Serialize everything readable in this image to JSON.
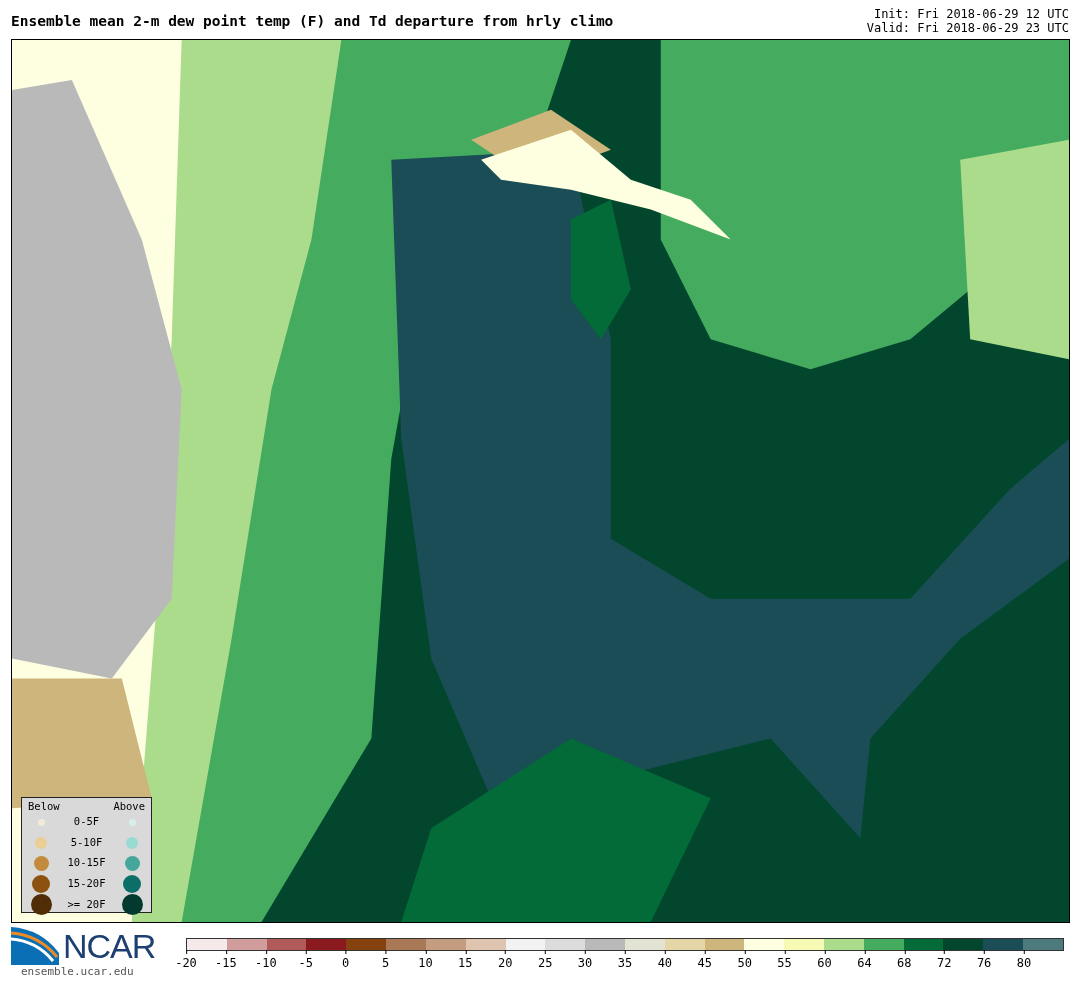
{
  "title": "Ensemble mean 2-m dew point temp (F) and Td departure from hrly climo",
  "init": "Init: Fri 2018-06-29 12 UTC",
  "valid": "Valid: Fri 2018-06-29 23 UTC",
  "legend": {
    "below_heading": "Below",
    "above_heading": "Above",
    "rows": [
      {
        "label": "0-5F",
        "below": {
          "color": "#f3ebd8"
        },
        "above": {
          "color": "#d7efec"
        }
      },
      {
        "label": "5-10F",
        "below": {
          "color": "#e9cf95"
        },
        "above": {
          "color": "#97dbd2"
        }
      },
      {
        "label": "10-15F",
        "below": {
          "color": "#c38b3d"
        },
        "above": {
          "color": "#45a69b"
        }
      },
      {
        "label": "15-20F",
        "below": {
          "color": "#8d520f"
        },
        "above": {
          "color": "#0b6f67"
        }
      },
      {
        "label": ">= 20F",
        "below": {
          "color": "#512d07"
        },
        "above": {
          "color": "#023a30"
        }
      }
    ]
  },
  "logo_text": "NCAR",
  "url": "ensemble.ucar.edu",
  "colorbar": {
    "segments": [
      {
        "color": "#f5e9e9"
      },
      {
        "color": "#d09c9c"
      },
      {
        "color": "#b05a5a"
      },
      {
        "color": "#8b1a1e"
      },
      {
        "color": "#85420f"
      },
      {
        "color": "#a97957"
      },
      {
        "color": "#c49c80"
      },
      {
        "color": "#dfc4b0"
      },
      {
        "color": "#f2f2f2"
      },
      {
        "color": "#dcdcdc"
      },
      {
        "color": "#b9b9b9"
      },
      {
        "color": "#e3e3d3"
      },
      {
        "color": "#e5d6a8"
      },
      {
        "color": "#cdb57c"
      },
      {
        "color": "#fefee0"
      },
      {
        "color": "#f6fab4"
      },
      {
        "color": "#abdc8c"
      },
      {
        "color": "#45ab5f"
      },
      {
        "color": "#036b37"
      },
      {
        "color": "#02472d"
      },
      {
        "color": "#1a4d55"
      },
      {
        "color": "#4d7a7c"
      }
    ],
    "ticks": [
      "-20",
      "-15",
      "-10",
      "-5",
      "0",
      "5",
      "10",
      "15",
      "20",
      "25",
      "30",
      "35",
      "40",
      "45",
      "50",
      "55",
      "60",
      "64",
      "68",
      "72",
      "76",
      "80"
    ]
  }
}
